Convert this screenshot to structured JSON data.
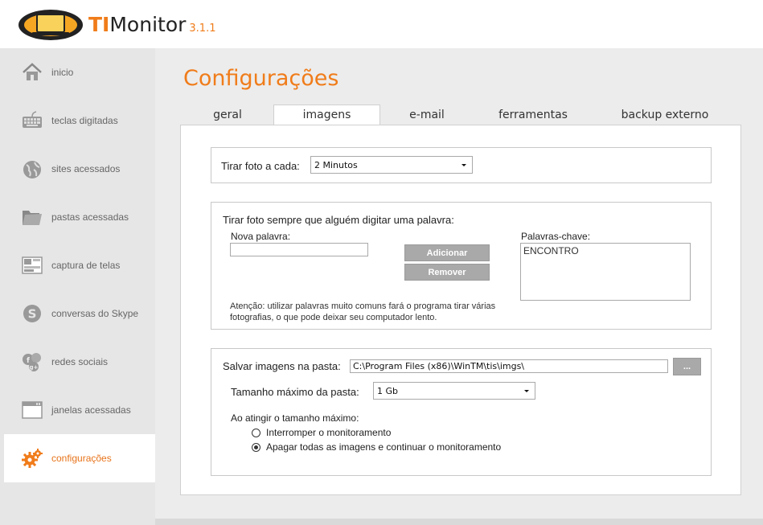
{
  "app": {
    "brand_prefix": "TI",
    "brand_suffix": "Monitor",
    "version": "3.1.1"
  },
  "sidebar": {
    "items": [
      {
        "label": "inicio",
        "icon": "home-icon"
      },
      {
        "label": "teclas digitadas",
        "icon": "keyboard-icon"
      },
      {
        "label": "sites acessados",
        "icon": "globe-icon"
      },
      {
        "label": "pastas acessadas",
        "icon": "folder-icon"
      },
      {
        "label": "captura de telas",
        "icon": "screenshot-icon"
      },
      {
        "label": "conversas do Skype",
        "icon": "skype-icon"
      },
      {
        "label": "redes sociais",
        "icon": "social-icon"
      },
      {
        "label": "janelas acessadas",
        "icon": "window-icon"
      },
      {
        "label": "configurações",
        "icon": "gear-icon",
        "active": true
      }
    ]
  },
  "main": {
    "title": "Configurações",
    "tabs": [
      {
        "label": "geral"
      },
      {
        "label": "imagens",
        "active": true
      },
      {
        "label": "e-mail"
      },
      {
        "label": "ferramentas"
      },
      {
        "label": "backup externo"
      }
    ]
  },
  "photo_interval": {
    "label": "Tirar foto a cada:",
    "value": "2 Minutos"
  },
  "keywords": {
    "heading": "Tirar foto sempre que alguém digitar uma palavra:",
    "new_word_label": "Nova palavra:",
    "new_word_value": "",
    "add_button": "Adicionar",
    "remove_button": "Remover",
    "list_label": "Palavras-chave:",
    "list_items": [
      "ENCONTRO"
    ],
    "warning": "Atenção: utilizar palavras muito comuns fará o programa tirar várias fotografias, o que pode deixar seu computador lento."
  },
  "storage": {
    "folder_label": "Salvar imagens na pasta:",
    "folder_value": "C:\\Program Files (x86)\\WinTM\\tis\\imgs\\",
    "browse_button": "...",
    "max_size_label": "Tamanho máximo da pasta:",
    "max_size_value": "1 Gb",
    "on_max_label": "Ao atingir o tamanho máximo:",
    "options": [
      {
        "label": "Interromper o monitoramento",
        "checked": false
      },
      {
        "label": "Apagar todas as imagens e continuar o monitoramento",
        "checked": true
      }
    ]
  },
  "colors": {
    "accent": "#f07c1a",
    "sidebar_bg": "#e6e6e6",
    "main_bg": "#ececec",
    "button_bg": "#a9a9a9"
  }
}
